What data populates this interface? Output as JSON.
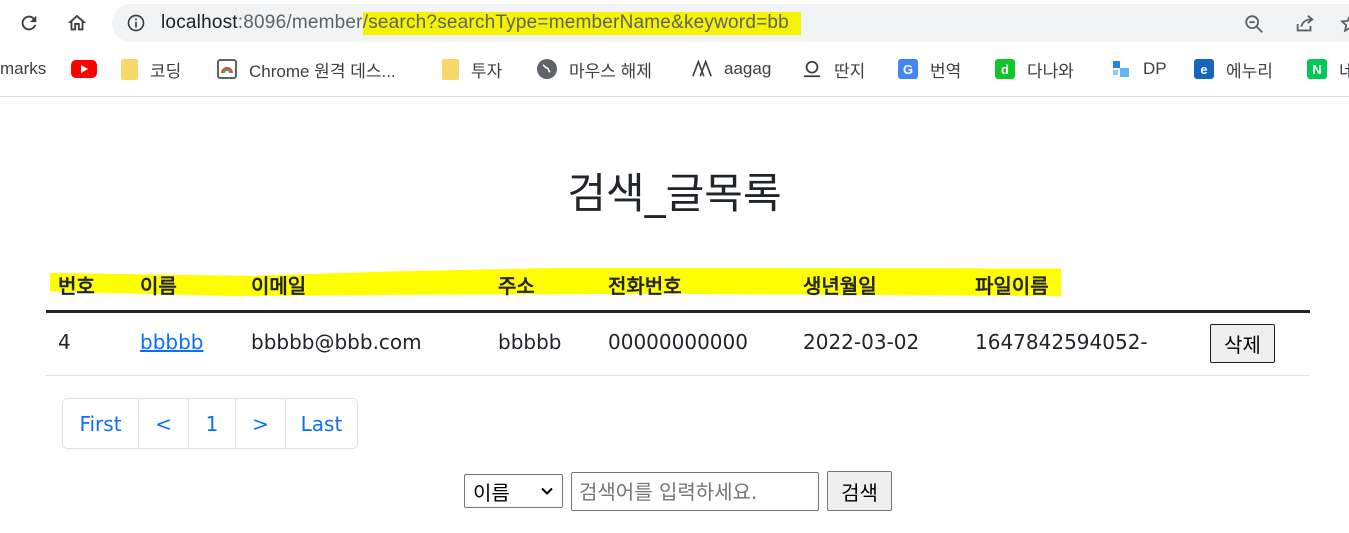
{
  "browser": {
    "url_host": "localhost",
    "url_port_path": ":8096/member",
    "url_query": "/search?searchType=memberName&keyword=bb",
    "bookmarks": [
      {
        "label": "marks",
        "icon": "none"
      },
      {
        "label": "",
        "icon": "youtube-icon",
        "color": "#ff0000"
      },
      {
        "label": "코딩",
        "icon": "folder-icon",
        "color": "#f7d96b"
      },
      {
        "label": "Chrome 원격 데스...",
        "icon": "chrome-remote-desktop-icon",
        "color": "#4285f4"
      },
      {
        "label": "투자",
        "icon": "folder-icon",
        "color": "#f7d96b"
      },
      {
        "label": "마우스 해제",
        "icon": "globe-icon",
        "color": "#5f6368"
      },
      {
        "label": "aagag",
        "icon": "aagag-logo-icon",
        "color": "#3c4043"
      },
      {
        "label": "딴지",
        "icon": "ddanzi-logo-icon",
        "color": "#3c4043"
      },
      {
        "label": "번역",
        "icon": "google-translate-icon",
        "color": "#4285f4"
      },
      {
        "label": "다나와",
        "icon": "danawa-logo-icon",
        "color": "#13c42b"
      },
      {
        "label": "DP",
        "icon": "dp-logo-icon",
        "color": "#3b82f6"
      },
      {
        "label": "에누리",
        "icon": "enuri-logo-icon",
        "color": "#1565c0"
      },
      {
        "label": "네",
        "icon": "naver-logo-icon",
        "color": "#03c75a"
      }
    ]
  },
  "page": {
    "title": "검색_글목록"
  },
  "table": {
    "headers": [
      "번호",
      "이름",
      "이메일",
      "주소",
      "전화번호",
      "생년월일",
      "파일이름"
    ],
    "rows": [
      {
        "no": "4",
        "name": "bbbbb",
        "email": "bbbbb@bbb.com",
        "address": "bbbbb",
        "phone": "00000000000",
        "birth": "2022-03-02",
        "file": "1647842594052-",
        "action": "삭제"
      }
    ]
  },
  "pagination": [
    "First",
    "<",
    "1",
    ">",
    "Last"
  ],
  "search": {
    "selected_type": "이름",
    "placeholder": "검색어를 입력하세요.",
    "button": "검색"
  },
  "colors": {
    "highlight": "#ffff00",
    "link": "#0d6efd"
  }
}
